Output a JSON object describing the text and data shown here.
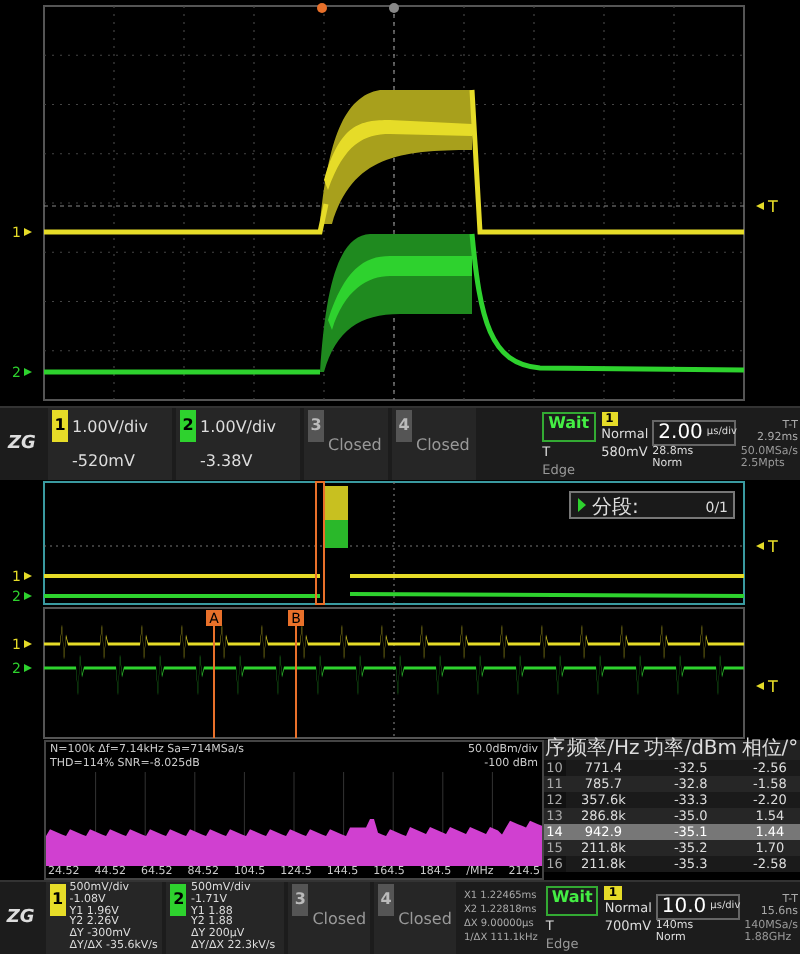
{
  "main_display": {
    "channel_markers": [
      {
        "label": "1",
        "color": "#e6dc28"
      },
      {
        "label": "2",
        "color": "#2ed22e"
      }
    ],
    "trigger_marker": "T"
  },
  "status_bar_top": {
    "logo": "ZG",
    "channels": [
      {
        "kind": "analog",
        "number": "1",
        "color": "#e6dc28",
        "lines": [
          "1.00V/div",
          "-520mV"
        ]
      },
      {
        "kind": "analog",
        "number": "2",
        "color": "#2ed22e",
        "lines": [
          "1.00V/div",
          "-3.38V"
        ]
      },
      {
        "kind": "closed",
        "number": "3",
        "label": "Closed"
      },
      {
        "kind": "closed",
        "number": "4",
        "label": "Closed"
      }
    ],
    "acquisition": {
      "state": "Wait",
      "source": "1",
      "mode": "Normal",
      "slope": "T",
      "level": "580mV",
      "type": "Edge"
    },
    "timebase": {
      "scale": "2.00",
      "unit": "μs/div",
      "tt_label": "T-T",
      "tt_value": "2.92ms",
      "rows": [
        [
          "28.8ms",
          "50.0MSa/s"
        ],
        [
          "Norm",
          "2.5Mpts"
        ]
      ]
    }
  },
  "zoom_overview": {
    "channel_markers": [
      {
        "label": "1",
        "color": "#e6dc28"
      },
      {
        "label": "2",
        "color": "#2ed22e"
      }
    ],
    "trigger_marker": "T",
    "segment": {
      "label": "分段:",
      "value": "0/1"
    }
  },
  "zoom_detail": {
    "cursors": [
      {
        "label": "A"
      },
      {
        "label": "B"
      }
    ],
    "channel_markers": [
      {
        "label": "1",
        "color": "#e6dc28"
      },
      {
        "label": "2",
        "color": "#2ed22e"
      }
    ],
    "trigger_marker": "T"
  },
  "fft": {
    "info_left": [
      "N=100k Δf=7.14kHz Sa=714MSa/s",
      "THD=114% SNR=-8.025dB"
    ],
    "info_right": [
      "50.0dBm/div",
      "-100 dBm"
    ],
    "x_labels": [
      "24.52",
      "44.52",
      "64.52",
      "84.52",
      "104.5",
      "124.5",
      "144.5",
      "164.5",
      "184.5",
      "/MHz",
      "214.5"
    ],
    "table": {
      "columns": [
        "序",
        "频率/Hz",
        "功率/dBm",
        "相位/°"
      ],
      "rows": [
        {
          "cells": [
            "10",
            "771.4",
            "-32.5",
            "-2.56"
          ],
          "selected": false
        },
        {
          "cells": [
            "11",
            "785.7",
            "-32.8",
            "-1.58"
          ],
          "selected": false
        },
        {
          "cells": [
            "12",
            "357.6k",
            "-33.3",
            "-2.20"
          ],
          "selected": false
        },
        {
          "cells": [
            "13",
            "286.8k",
            "-35.0",
            "1.54"
          ],
          "selected": false
        },
        {
          "cells": [
            "14",
            "942.9",
            "-35.1",
            "1.44"
          ],
          "selected": true
        },
        {
          "cells": [
            "15",
            "211.8k",
            "-35.2",
            "1.70"
          ],
          "selected": false
        },
        {
          "cells": [
            "16",
            "211.8k",
            "-35.3",
            "-2.58"
          ],
          "selected": false
        }
      ]
    }
  },
  "status_bar_bottom": {
    "logo": "ZG",
    "channels": [
      {
        "kind": "analog",
        "number": "1",
        "color": "#e6dc28",
        "lines": [
          "500mV/div",
          "-1.08V",
          "Y1 1.96V",
          "Y2 2.26V",
          "ΔY -300mV",
          "ΔY/ΔX -35.6kV/s"
        ]
      },
      {
        "kind": "analog",
        "number": "2",
        "color": "#2ed22e",
        "lines": [
          "500mV/div",
          "-1.71V",
          "Y1 1.88",
          "Y2 1.88",
          "ΔY 200μV",
          "ΔY/ΔX 22.3kV/s"
        ]
      },
      {
        "kind": "closed",
        "number": "3",
        "label": "Closed"
      },
      {
        "kind": "closed",
        "number": "4",
        "label": "Closed"
      }
    ],
    "cursors": [
      "X1 1.22465ms",
      "X2 1.22818ms",
      "ΔX 9.00000μs",
      "1/ΔX 111.1kHz"
    ],
    "acquisition": {
      "state": "Wait",
      "source": "1",
      "mode": "Normal",
      "slope": "T",
      "level": "700mV",
      "type": "Edge"
    },
    "timebase": {
      "scale": "10.0",
      "unit": "μs/div",
      "tt_label": "T-T",
      "tt_value": "15.6ns",
      "rows": [
        [
          "140ms",
          "140MSa/s"
        ],
        [
          "Norm",
          "1.88GHz"
        ]
      ]
    }
  }
}
